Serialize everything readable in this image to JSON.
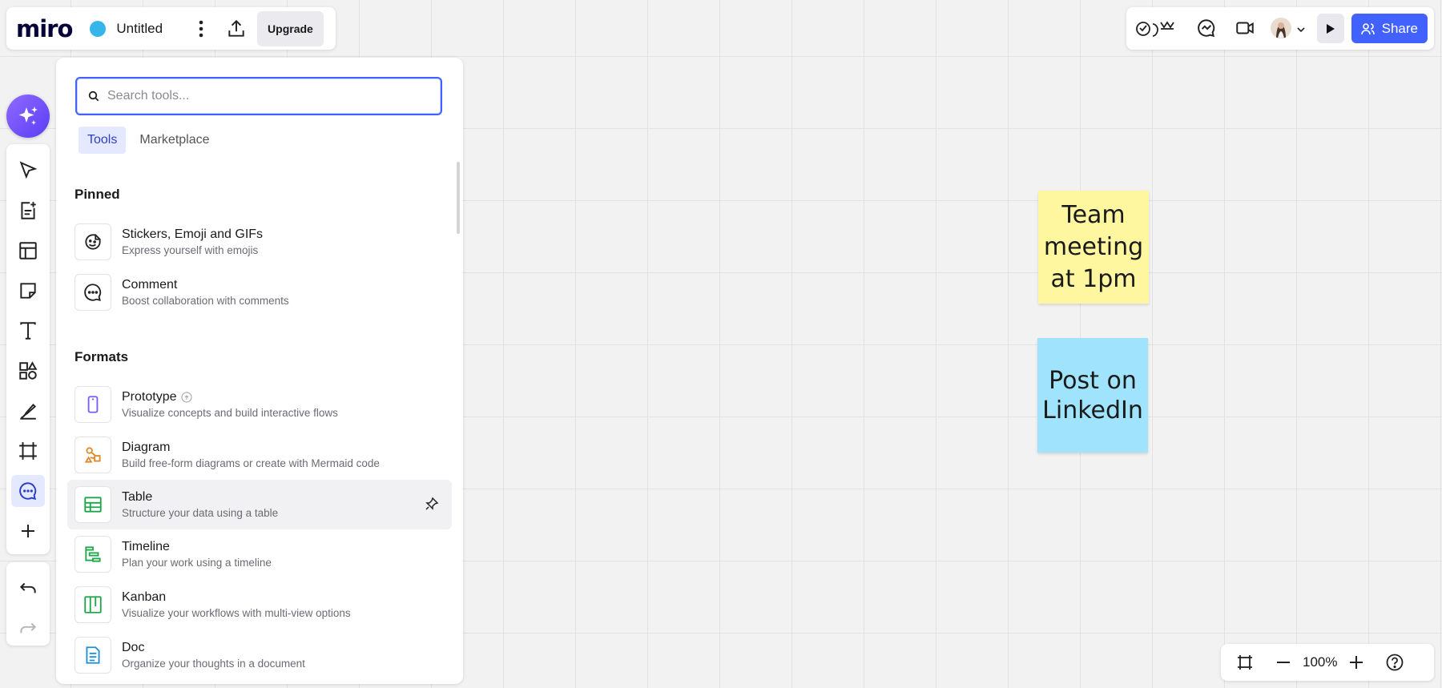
{
  "app": {
    "logo_text": "miro",
    "board_title": "Untitled"
  },
  "header": {
    "upgrade_label": "Upgrade",
    "share_label": "Share"
  },
  "tools_panel": {
    "search_placeholder": "Search tools...",
    "tabs": [
      {
        "label": "Tools",
        "active": true
      },
      {
        "label": "Marketplace",
        "active": false
      }
    ],
    "sections": [
      {
        "title": "Pinned",
        "items": [
          {
            "name": "Stickers, Emoji and GIFs",
            "description": "Express yourself with emojis",
            "icon": "sticker-icon"
          },
          {
            "name": "Comment",
            "description": "Boost collaboration with comments",
            "icon": "comment-icon"
          }
        ]
      },
      {
        "title": "Formats",
        "items": [
          {
            "name": "Prototype",
            "description": "Visualize concepts and build interactive flows",
            "icon": "prototype-icon"
          },
          {
            "name": "Diagram",
            "description": "Build free-form diagrams or create with Mermaid code",
            "icon": "diagram-icon"
          },
          {
            "name": "Table",
            "description": "Structure your data using a table",
            "icon": "table-icon"
          },
          {
            "name": "Timeline",
            "description": "Plan your work using a timeline",
            "icon": "timeline-icon"
          },
          {
            "name": "Kanban",
            "description": "Visualize your workflows with multi-view options",
            "icon": "kanban-icon"
          },
          {
            "name": "Doc",
            "description": "Organize your thoughts in a document",
            "icon": "doc-icon"
          }
        ]
      }
    ]
  },
  "canvas": {
    "stickies": [
      {
        "text": "Team meeting at 1pm",
        "color": "#fff6a0"
      },
      {
        "text": "Post on LinkedIn",
        "color": "#9fe4fc"
      }
    ]
  },
  "zoom": {
    "level": "100%"
  },
  "colors": {
    "accent": "#4262ff",
    "ai_button": "#6b4cf6"
  }
}
